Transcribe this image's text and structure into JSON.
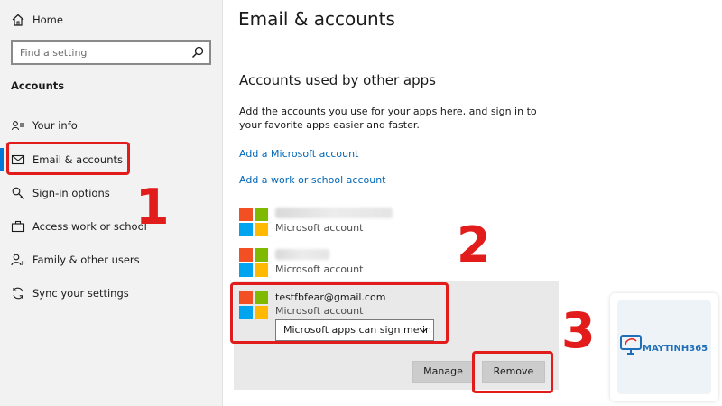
{
  "sidebar": {
    "home_label": "Home",
    "search_placeholder": "Find a setting",
    "section_heading": "Accounts",
    "items": [
      {
        "label": "Your info",
        "icon": "person-card-icon"
      },
      {
        "label": "Email & accounts",
        "icon": "mail-icon"
      },
      {
        "label": "Sign-in options",
        "icon": "key-icon"
      },
      {
        "label": "Access work or school",
        "icon": "briefcase-icon"
      },
      {
        "label": "Family & other users",
        "icon": "person-add-icon"
      },
      {
        "label": "Sync your settings",
        "icon": "sync-icon"
      }
    ]
  },
  "main": {
    "title": "Email & accounts",
    "section_title": "Accounts used by other apps",
    "description": "Add the accounts you use for your apps here, and sign in to your favorite apps easier and faster.",
    "links": {
      "add_microsoft": "Add a Microsoft account",
      "add_work": "Add a work or school account"
    },
    "accounts": [
      {
        "type": "Microsoft account"
      },
      {
        "type": "Microsoft account"
      },
      {
        "email": "testfbfear@gmail.com",
        "type": "Microsoft account"
      }
    ],
    "dropdown_value": "Microsoft apps can sign me in",
    "buttons": {
      "manage": "Manage",
      "remove": "Remove"
    }
  },
  "annotations": {
    "step1": "1",
    "step2": "2",
    "step3": "3"
  },
  "watermark": {
    "brand": "MAYTINH365"
  },
  "colors": {
    "accent": "#0078d7",
    "link": "#0067b8",
    "highlight_red": "#e21b1b"
  }
}
